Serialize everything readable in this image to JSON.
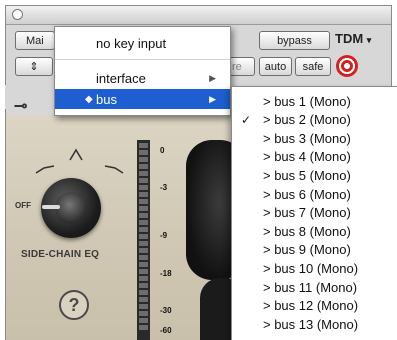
{
  "window": {
    "left_button_label": "Mai",
    "bypass_label": "bypass",
    "plugin_type_label": "TDM",
    "plugin_type_arrow": "▾",
    "auto_label": "auto",
    "safe_label": "safe",
    "partial_button_label": "re",
    "stepper_label": "⇕",
    "target_icon": "target-icon",
    "key_icon": "key-icon"
  },
  "plugin": {
    "off_label": "OFF",
    "sidechain_eq_label": "SIDE-CHAIN EQ",
    "help_label": "?",
    "meter_scale": [
      "0",
      "-3",
      "-9",
      "-18",
      "-30",
      "-60"
    ],
    "accent_colors": {
      "panel": "#cfc7b3",
      "knob": "#1d1d1d",
      "target": "#d62020"
    }
  },
  "key_input_menu": {
    "items": [
      {
        "label": "no key input",
        "has_submenu": false,
        "selected": false
      },
      {
        "label": "interface",
        "has_submenu": true,
        "selected": false
      },
      {
        "label": "bus",
        "has_submenu": true,
        "selected": true
      }
    ],
    "submenu_arrow": "▶",
    "bullet": "◆",
    "selected_color": "#1d5fd0"
  },
  "bus_submenu": {
    "checkmark": "✓",
    "items": [
      {
        "label": "> bus 1 (Mono)",
        "checked": false
      },
      {
        "label": "> bus 2 (Mono)",
        "checked": true
      },
      {
        "label": "> bus 3 (Mono)",
        "checked": false
      },
      {
        "label": "> bus 4 (Mono)",
        "checked": false
      },
      {
        "label": "> bus 5 (Mono)",
        "checked": false
      },
      {
        "label": "> bus 6 (Mono)",
        "checked": false
      },
      {
        "label": "> bus 7 (Mono)",
        "checked": false
      },
      {
        "label": "> bus 8 (Mono)",
        "checked": false
      },
      {
        "label": "> bus 9 (Mono)",
        "checked": false
      },
      {
        "label": "> bus 10 (Mono)",
        "checked": false
      },
      {
        "label": "> bus 11 (Mono)",
        "checked": false
      },
      {
        "label": "> bus 12 (Mono)",
        "checked": false
      },
      {
        "label": "> bus 13 (Mono)",
        "checked": false
      }
    ]
  }
}
